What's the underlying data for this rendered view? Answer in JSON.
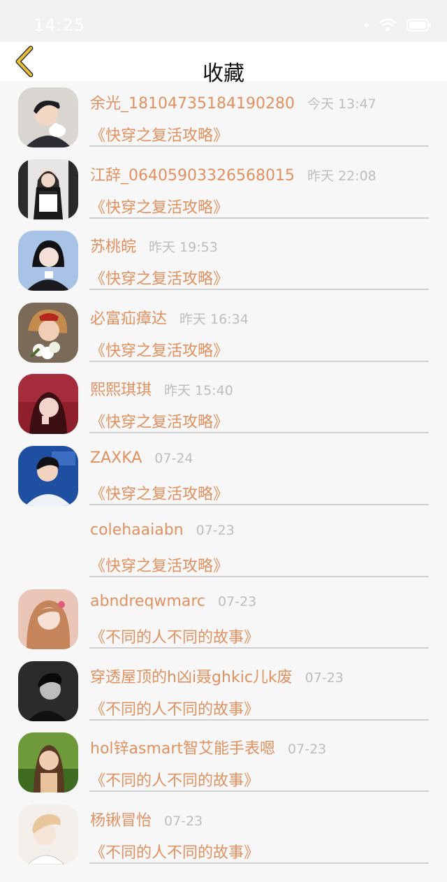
{
  "status_bar": {
    "time": "14:25"
  },
  "nav": {
    "title": "收藏",
    "back_icon": "chevron-left-icon",
    "accent": "#e0b430"
  },
  "colors": {
    "name": "#e0915f",
    "time": "#bdbdbd",
    "divider": "#cfcfcf"
  },
  "items": [
    {
      "name": "余光_18104735184190280",
      "time": "今天 13:47",
      "book": "《快穿之复活攻略》",
      "avatar": "avatar-man-with-cat"
    },
    {
      "name": "江辞_06405903326568015",
      "time": "昨天 22:08",
      "book": "《快穿之复活攻略》",
      "avatar": "avatar-girl-dark-hair"
    },
    {
      "name": "苏桃皖",
      "time": "昨天 19:53",
      "book": "《快穿之复活攻略》",
      "avatar": "avatar-girl-blue"
    },
    {
      "name": "必富疝瘴达",
      "time": "昨天 16:34",
      "book": "《快穿之复活攻略》",
      "avatar": "avatar-girl-flowers"
    },
    {
      "name": "熙熙琪琪",
      "time": "昨天 15:40",
      "book": "《快穿之复活攻略》",
      "avatar": "avatar-girl-red"
    },
    {
      "name": "ZAXKA",
      "time": "07-24",
      "book": "《快穿之复活攻略》",
      "avatar": "avatar-boy-blue"
    },
    {
      "name": "colehaaiabn",
      "time": "07-23",
      "book": "《快穿之复活攻略》",
      "avatar": ""
    },
    {
      "name": "abndreqwmarc",
      "time": "07-23",
      "book": "《不同的人不同的故事》",
      "avatar": "avatar-girl-blonde"
    },
    {
      "name": "穿透屋顶的h凶i聂ghkic儿k废",
      "time": "07-23",
      "book": "《不同的人不同的故事》",
      "avatar": "avatar-man-dark"
    },
    {
      "name": "hol锌asmart智艾能手表嗯",
      "time": "07-23",
      "book": "《不同的人不同的故事》",
      "avatar": "avatar-woman-garden"
    },
    {
      "name": "杨锹冒怡",
      "time": "07-23",
      "book": "《不同的人不同的故事》",
      "avatar": "avatar-boy-sketch"
    }
  ]
}
